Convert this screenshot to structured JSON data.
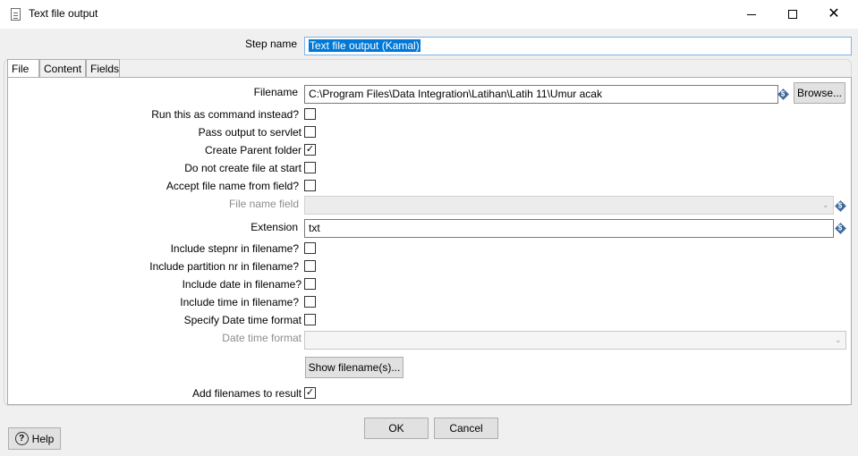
{
  "window": {
    "title": "Text file output",
    "minimize_icon": "minimize-icon",
    "maximize_icon": "maximize-icon",
    "close_icon": "close-icon"
  },
  "step": {
    "label": "Step name",
    "value": "Text file output (Kamal)"
  },
  "tabs": [
    {
      "label": "File",
      "active": true
    },
    {
      "label": "Content",
      "active": false
    },
    {
      "label": "Fields",
      "active": false
    }
  ],
  "file_tab": {
    "filename": {
      "label": "Filename",
      "value": "C:\\Program Files\\Data Integration\\Latihan\\Latih 11\\Umur acak",
      "browse_label": "Browse..."
    },
    "run_as_command": {
      "label": "Run this as command instead?",
      "checked": false
    },
    "pass_to_servlet": {
      "label": "Pass output to servlet",
      "checked": false
    },
    "create_parent_folder": {
      "label": "Create Parent folder",
      "checked": true
    },
    "do_not_create_file": {
      "label": "Do not create file at start",
      "checked": false
    },
    "accept_filename": {
      "label": "Accept file name from field?",
      "checked": false
    },
    "file_name_field": {
      "label": "File name field",
      "value": "",
      "disabled": true
    },
    "extension": {
      "label": "Extension",
      "value": "txt"
    },
    "include_stepnr": {
      "label": "Include stepnr in filename?",
      "checked": false
    },
    "include_partition": {
      "label": "Include partition nr in filename?",
      "checked": false
    },
    "include_date": {
      "label": "Include date in filename?",
      "checked": false
    },
    "include_time": {
      "label": "Include time in filename?",
      "checked": false
    },
    "specify_datetime": {
      "label": "Specify Date time format",
      "checked": false
    },
    "datetime_format": {
      "label": "Date time format",
      "value": "",
      "disabled": true
    },
    "show_filenames_label": "Show filename(s)...",
    "add_to_result": {
      "label": "Add filenames to result",
      "checked": true
    }
  },
  "footer": {
    "ok_label": "OK",
    "cancel_label": "Cancel",
    "help_label": "Help"
  },
  "glyphs": {
    "check": "✓",
    "chevron": "⌄",
    "close": "✕",
    "help": "?",
    "variable": "$"
  },
  "colors": {
    "selection": "#0078d7",
    "variable_icon": "#3d6a9c",
    "dialog_bg": "#f0f0f0"
  }
}
